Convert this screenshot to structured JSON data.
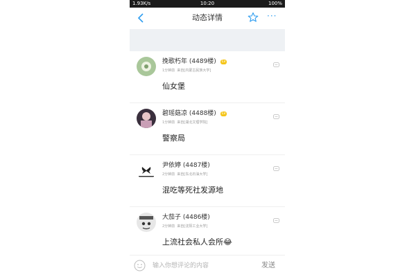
{
  "statusbar": {
    "network_speed": "1.93K/s",
    "time": "10:20",
    "battery": "100%"
  },
  "header": {
    "title": "动态详情",
    "back_icon": "back-chevron-icon",
    "star_icon": "star-icon",
    "more_icon": "more-icon",
    "more_glyph": "···"
  },
  "comments": [
    {
      "name": "挽歌朽年",
      "floor": "(4489楼)",
      "badge": "Lv",
      "time": "1分钟前",
      "source": "来自[内蒙古民族大学]",
      "body": "仙女堡"
    },
    {
      "name": "碧瑶菇凉",
      "floor": "(4488楼)",
      "badge": "Lv",
      "time": "1分钟前",
      "source": "来自[湖北文理学院]",
      "body": "警察局"
    },
    {
      "name": "尹依婷",
      "floor": "(4487楼)",
      "time": "2分钟前",
      "source": "来自[东北石油大学]",
      "body": "混吃等死社发源地"
    },
    {
      "name": "大茄子",
      "floor": "(4486楼)",
      "time": "2分钟前",
      "source": "来自[沈阳工业大学]",
      "body": "上流社会私人会所",
      "body_emoji": "😂"
    }
  ],
  "input": {
    "placeholder": "输入你想评论的内容",
    "send_label": "发送"
  },
  "colors": {
    "accent": "#2f9df0",
    "badge": "#f5c518"
  }
}
